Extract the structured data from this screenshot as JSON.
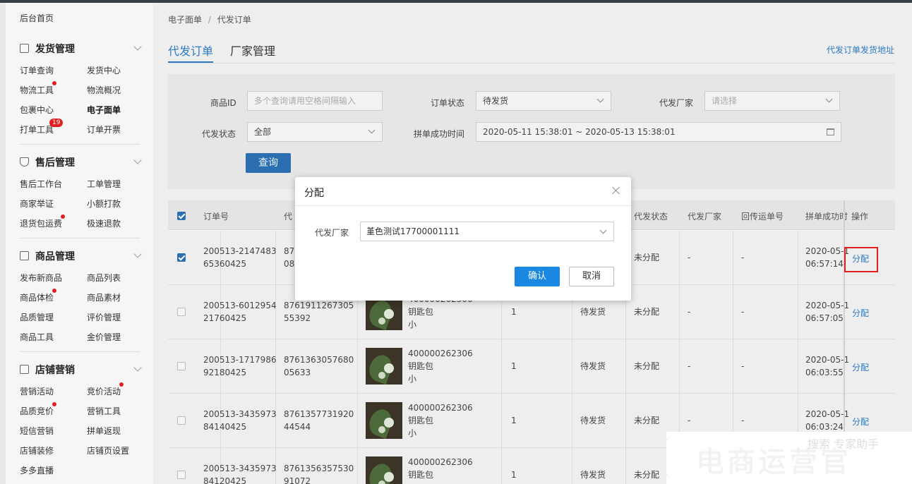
{
  "sidebar": {
    "home": "后台首页",
    "groups": [
      {
        "title": "发货管理",
        "icon": "document-icon",
        "items": [
          "订单查询",
          "发货中心",
          "物流工具",
          "物流概况",
          "包裹中心",
          "电子面单",
          "打单工具",
          "订单开票"
        ],
        "badge": "19"
      },
      {
        "title": "售后管理",
        "icon": "shield-icon",
        "items": [
          "售后工作台",
          "工单管理",
          "商家举证",
          "小额打款",
          "退货包运费",
          "极速退款"
        ]
      },
      {
        "title": "商品管理",
        "icon": "box-icon",
        "items": [
          "发布新商品",
          "商品列表",
          "商品体检",
          "商品素材",
          "品质管理",
          "评价管理",
          "商品工具",
          "金价管理"
        ]
      },
      {
        "title": "店铺营销",
        "icon": "shop-icon",
        "items": [
          "营销活动",
          "竞价活动",
          "品质竞价",
          "营销工具",
          "短信营销",
          "拼单返现",
          "店铺装修",
          "店铺页设置",
          "多多直播"
        ]
      }
    ]
  },
  "breadcrumb": {
    "parent": "电子面单",
    "sep": "/",
    "current": "代发订单"
  },
  "tabs": {
    "active": "代发订单",
    "other": "厂家管理"
  },
  "addr_link": "代发订单发货地址",
  "filter": {
    "goods_id_label": "商品ID",
    "goods_id_placeholder": "多个查询请用空格间隔输入",
    "order_status_label": "订单状态",
    "order_status_value": "待发货",
    "factory_label": "代发厂家",
    "factory_placeholder": "请选择",
    "proxy_status_label": "代发状态",
    "proxy_status_value": "全部",
    "group_time_label": "拼单成功时间",
    "group_time_value": "2020-05-11 15:38:01 ~ 2020-05-13 15:38:01",
    "query_button": "查询"
  },
  "table": {
    "headers": {
      "order_no": "订单号",
      "proxy": "代",
      "proxy_status": "代发状态",
      "factory": "代发厂家",
      "tracking": "回传运单号",
      "time": "拼单成功时",
      "action": "操作"
    },
    "rows": [
      {
        "order1": "200513-2147483",
        "order2": "65360425",
        "code1": "876",
        "code2": "08",
        "sku": "",
        "name": "",
        "spec": "",
        "qty": "",
        "status": "",
        "proxy": "未分配",
        "factory": "-",
        "tracking": "-",
        "time1": "2020-05-1",
        "time2": "06:57:14",
        "action": "分配",
        "checked": true
      },
      {
        "order1": "200513-6012954",
        "order2": "21760425",
        "code1": "8761911267305",
        "code2": "55392",
        "sku": "400000262306",
        "name": "钥匙包",
        "spec": "小",
        "qty": "1",
        "status": "待发货",
        "proxy": "未分配",
        "factory": "-",
        "tracking": "-",
        "time1": "2020-05-1",
        "time2": "06:57:05",
        "action": "分配",
        "checked": false
      },
      {
        "order1": "200513-1717986",
        "order2": "92180425",
        "code1": "8761363057680",
        "code2": "05633",
        "sku": "400000262306",
        "name": "钥匙包",
        "spec": "小",
        "qty": "1",
        "status": "待发货",
        "proxy": "未分配",
        "factory": "-",
        "tracking": "-",
        "time1": "2020-05-1",
        "time2": "06:03:55",
        "action": "分配",
        "checked": false
      },
      {
        "order1": "200513-3435973",
        "order2": "84140425",
        "code1": "8761357731920",
        "code2": "44544",
        "sku": "400000262306",
        "name": "钥匙包",
        "spec": "小",
        "qty": "1",
        "status": "待发货",
        "proxy": "未分配",
        "factory": "-",
        "tracking": "-",
        "time1": "2020-05-1",
        "time2": "06:03:24",
        "action": "分配",
        "checked": false
      },
      {
        "order1": "200513-3435973",
        "order2": "84120425",
        "code1": "8761356357530",
        "code2": "91072",
        "sku": "400000262306",
        "name": "钥匙包",
        "spec": "",
        "qty": "1",
        "status": "待发货",
        "proxy": "未分配",
        "factory": "",
        "tracking": "",
        "time1": "",
        "time2": "",
        "action": "",
        "checked": false
      }
    ]
  },
  "dialog": {
    "title": "分配",
    "factory_label": "代发厂家",
    "factory_value": "堇色测试17700001111",
    "ok": "确认",
    "cancel": "取消"
  },
  "watermark": {
    "text": "电商运营官",
    "sub": "搜索 专家助手"
  }
}
